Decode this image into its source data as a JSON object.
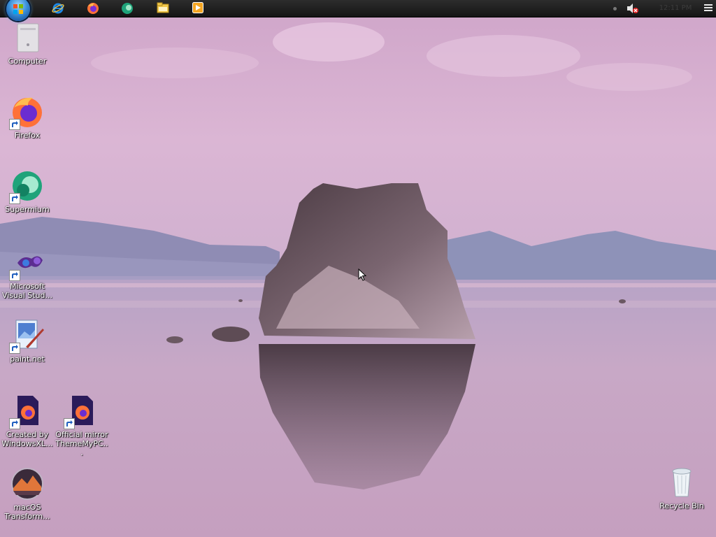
{
  "taskbar": {
    "start_button": "start-orb-icon",
    "pinned_apps": [
      {
        "name": "internet-explorer-icon",
        "accent": "#1e88e5"
      },
      {
        "name": "firefox-icon",
        "accent": "#ff7139"
      },
      {
        "name": "supermium-icon",
        "accent": "#1fa37a"
      },
      {
        "name": "file-explorer-icon",
        "accent": "#f2c94c"
      },
      {
        "name": "media-player-icon",
        "accent": "#f5a623"
      }
    ],
    "tray": {
      "volume_state": "muted",
      "clock": "12:11 PM"
    }
  },
  "desktop": {
    "icons": [
      {
        "label": "Computer",
        "icon": "computer-icon"
      },
      {
        "label": "Firefox",
        "icon": "firefox-icon"
      },
      {
        "label": "Supermium",
        "icon": "supermium-icon"
      },
      {
        "label": "Microsoft Visual Stud...",
        "icon": "visual-studio-icon"
      },
      {
        "label": "paint.net",
        "icon": "paint-net-icon"
      },
      {
        "label": "Created by WindowsXL...",
        "icon": "firefox-file-icon"
      },
      {
        "label": "Official mirror ThemeMyPC...",
        "icon": "firefox-file-icon"
      },
      {
        "label": "macOS Transform...",
        "icon": "macos-icon"
      },
      {
        "label": "Recycle Bin",
        "icon": "recycle-bin-icon"
      }
    ]
  },
  "wallpaper": {
    "sky_color": "#d7b3d0",
    "water_color": "#c9a3c2",
    "mountain_color": "#8d8fb6",
    "rock_color": "#5c4a52"
  }
}
